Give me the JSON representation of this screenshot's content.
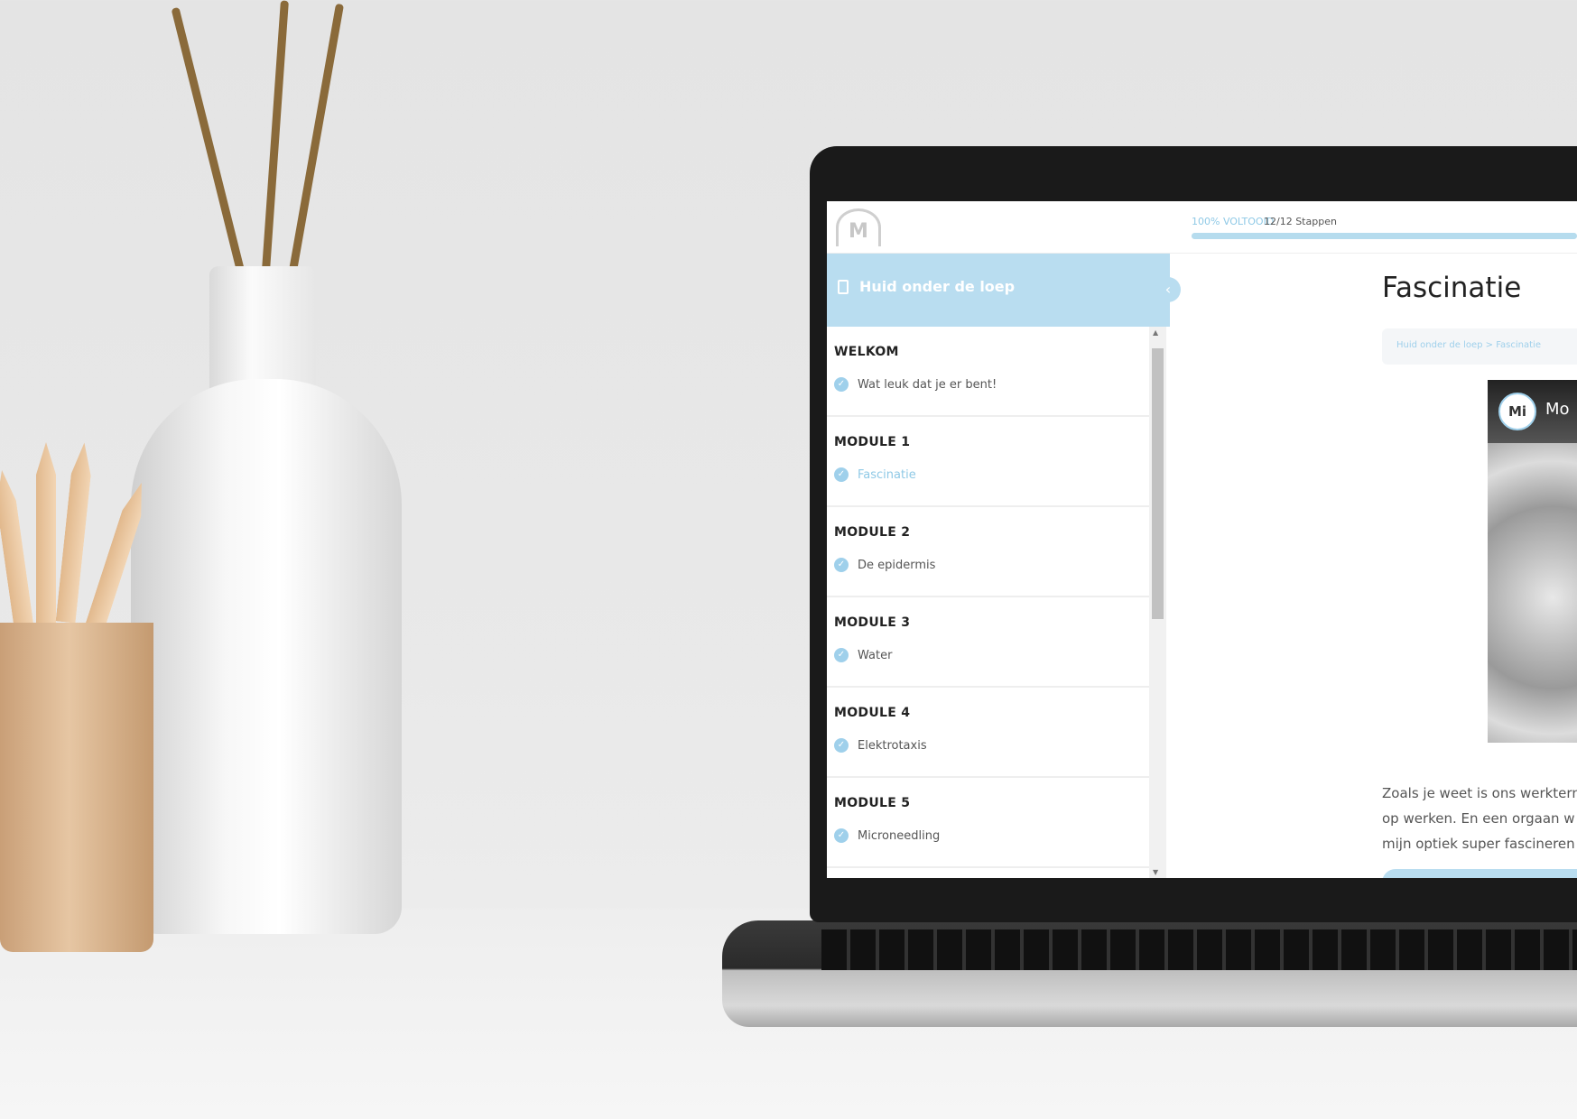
{
  "header": {
    "logo_text": "M",
    "progress_label": "100% VOLTOOID",
    "progress_value": 100,
    "steps": "12/12 Stappen"
  },
  "sidebar": {
    "course_title": "Huid onder de loep",
    "sections": [
      {
        "title": "WELKOM",
        "lesson": "Wat leuk dat je er bent!"
      },
      {
        "title": "MODULE 1",
        "lesson": "Fascinatie",
        "active": true
      },
      {
        "title": "MODULE 2",
        "lesson": "De epidermis"
      },
      {
        "title": "MODULE 3",
        "lesson": "Water"
      },
      {
        "title": "MODULE 4",
        "lesson": "Elektrotaxis"
      },
      {
        "title": "MODULE 5",
        "lesson": "Microneedling"
      }
    ]
  },
  "main": {
    "title": "Fascinatie",
    "breadcrumb": "Huid onder de loep > Fascinatie",
    "video": {
      "channel_logo": "Mi",
      "channel_name": "Mo"
    },
    "paragraph": [
      "Zoals je weet is ons werktern",
      "op werken. En een orgaan w",
      "mijn optiek super fascineren"
    ]
  },
  "colors": {
    "accent": "#b9ddf0",
    "active_lesson": "#8fc9e6"
  }
}
